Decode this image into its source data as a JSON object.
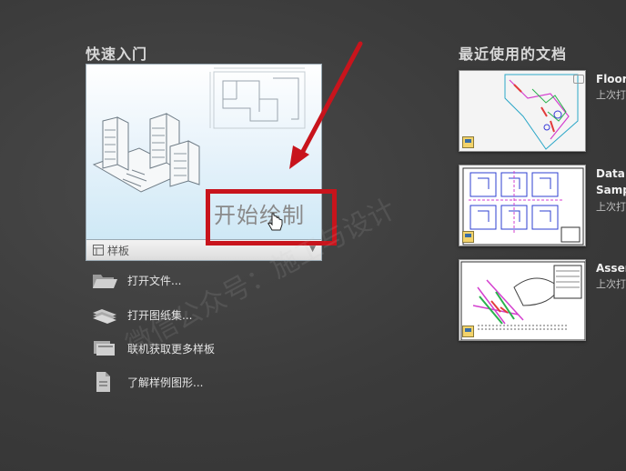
{
  "quick_start": {
    "title": "快速入门",
    "start_drawing_label": "开始绘制",
    "template_label": "样板",
    "actions": [
      {
        "label": "打开文件...",
        "icon": "folder-icon"
      },
      {
        "label": "打开图纸集...",
        "icon": "sheet-set-icon"
      },
      {
        "label": "联机获取更多样板",
        "icon": "online-templates-icon"
      },
      {
        "label": "了解样例图形...",
        "icon": "sample-drawings-icon"
      }
    ]
  },
  "recent": {
    "title": "最近使用的文档",
    "documents": [
      {
        "name": "Floor",
        "sub": "上次打"
      },
      {
        "name": "Data",
        "name2": "Samp",
        "sub": "上次打"
      },
      {
        "name": "Assen",
        "sub": "上次打"
      }
    ]
  },
  "watermark": "微信公众号：施工与设计",
  "colors": {
    "highlight": "#c8141c",
    "background": "#3b3b3b"
  }
}
